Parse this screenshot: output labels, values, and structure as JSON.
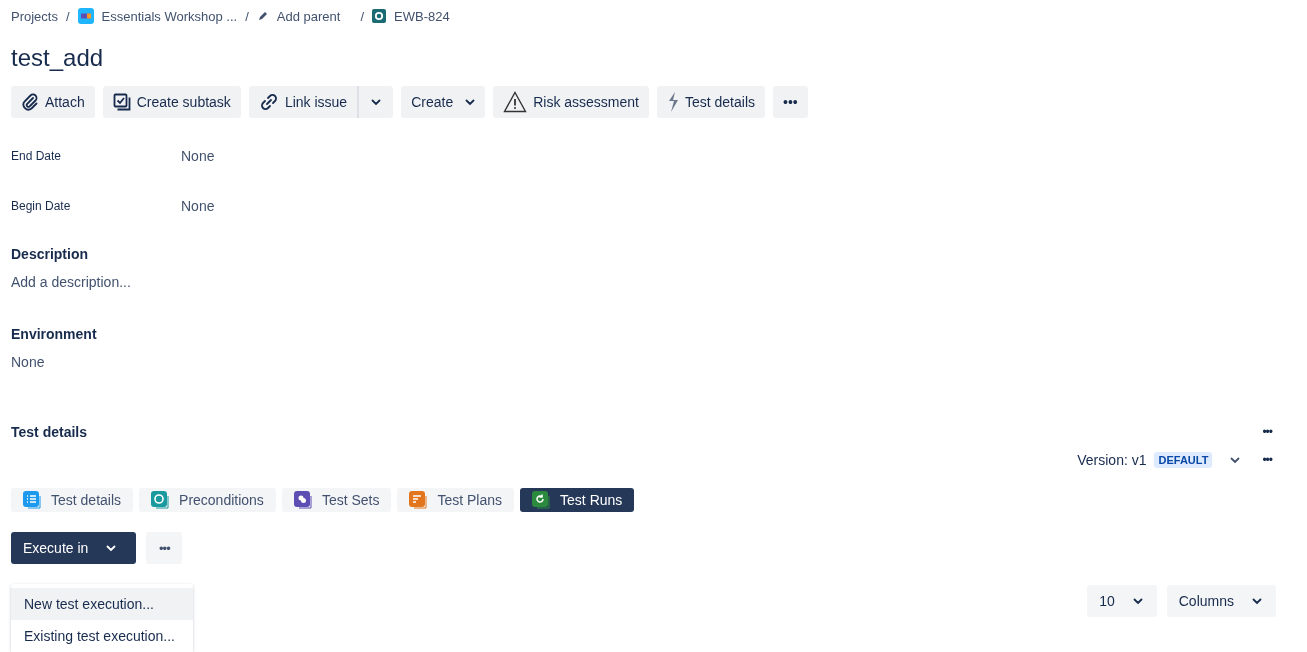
{
  "breadcrumbs": [
    {
      "label": "Projects",
      "separator": "/"
    },
    {
      "label": "Essentials Workshop ...",
      "separator": "/"
    },
    {
      "label": "Add parent",
      "separator": "/"
    },
    {
      "label": "EWB-824"
    }
  ],
  "title": "test_add",
  "toolbar": [
    {
      "label": "Attach",
      "kind": "button"
    },
    {
      "label": "Create subtask",
      "kind": "button"
    },
    {
      "label": "Link issue",
      "kind": "split"
    },
    {
      "label": "Create",
      "kind": "dropdown"
    },
    {
      "label": "Risk assessment",
      "kind": "button"
    },
    {
      "label": "Test details",
      "kind": "button"
    },
    {
      "label": "•••",
      "kind": "button"
    }
  ],
  "fields": [
    {
      "label": "End Date",
      "value": "None"
    },
    {
      "label": "Begin Date",
      "value": "None"
    }
  ],
  "sections": [
    {
      "heading": "Description",
      "placeholder": "Add a description..."
    },
    {
      "heading": "Environment",
      "value": "None"
    }
  ],
  "test_details": {
    "heading": "Test details",
    "more": "•••",
    "version": "Version: v1",
    "badge": "DEFAULT",
    "version_more": "•••",
    "tabs": [
      {
        "label": "Test details",
        "color": "#1d9aee",
        "selected": false
      },
      {
        "label": "Preconditions",
        "color": "#1a9a9e",
        "selected": false
      },
      {
        "label": "Test Sets",
        "color": "#5e4db2",
        "selected": false
      },
      {
        "label": "Test Plans",
        "color": "#e2761f",
        "selected": false
      },
      {
        "label": "Test Runs",
        "color": "#2b8a3e",
        "selected": true
      }
    ],
    "execute_button": "Execute in",
    "more_button": "•••",
    "menu": [
      "New test execution...",
      "Existing test execution..."
    ],
    "page_size": "10",
    "columns_button": "Columns"
  }
}
